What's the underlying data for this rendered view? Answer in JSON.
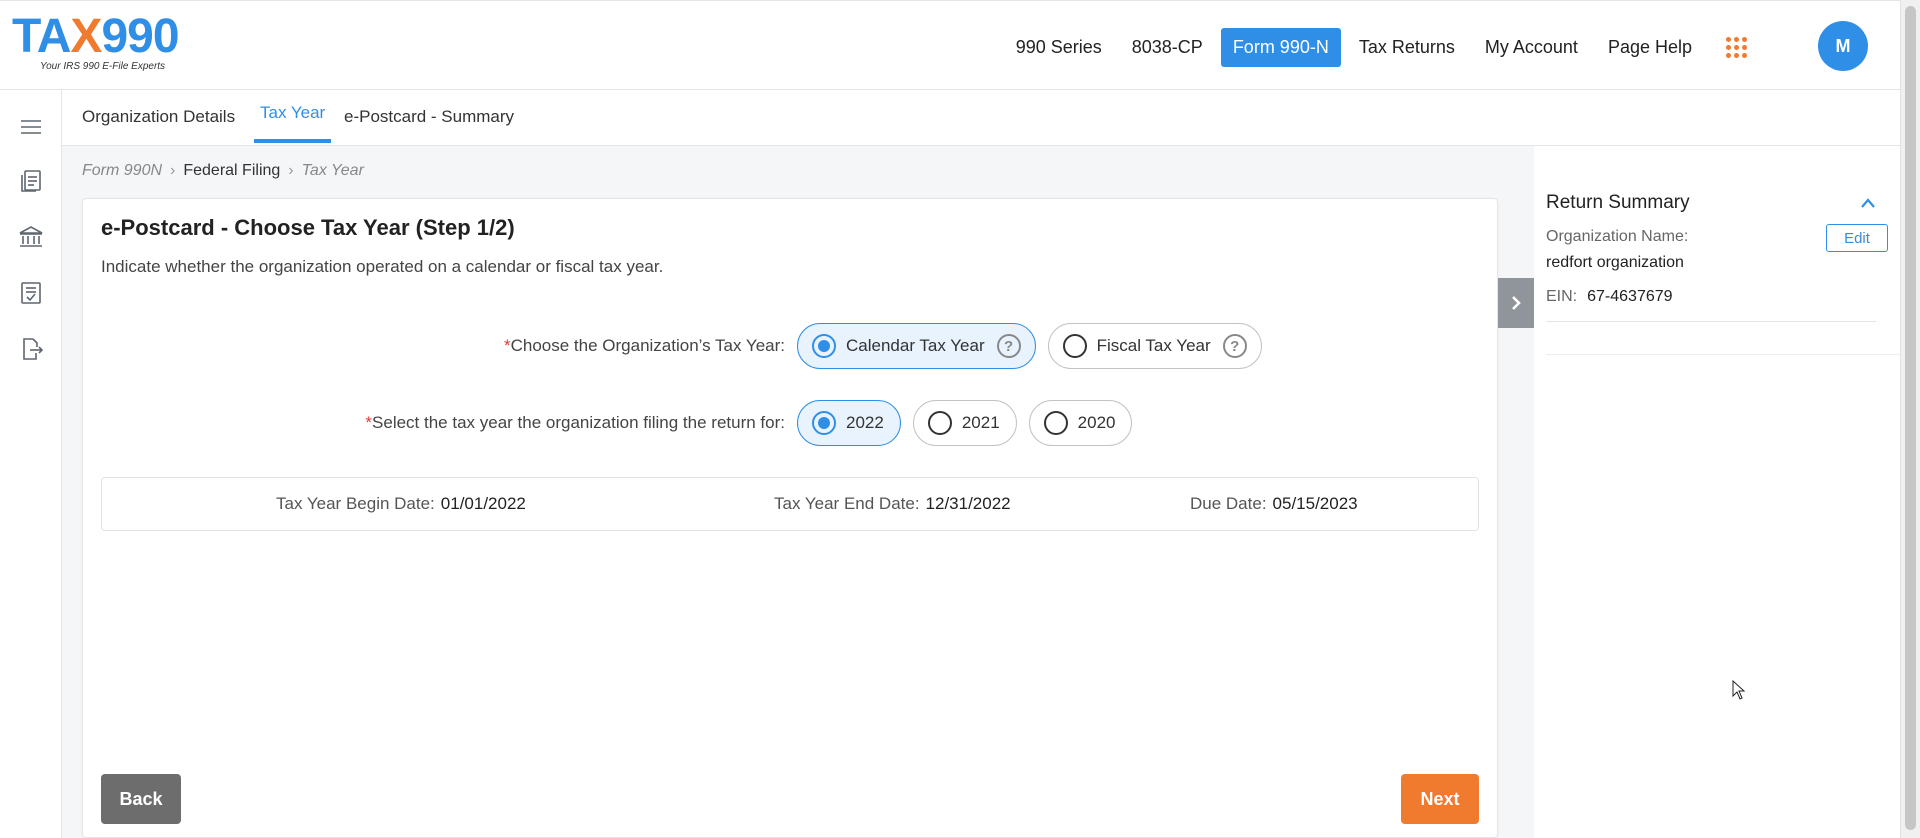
{
  "header": {
    "logo_main_a": "TA",
    "logo_main_x": "X",
    "logo_main_b": "990",
    "logo_tagline": "Your IRS 990 E-File Experts",
    "nav": [
      {
        "label": "990 Series"
      },
      {
        "label": "8038-CP"
      },
      {
        "label": "Form 990-N"
      },
      {
        "label": "Tax Returns"
      },
      {
        "label": "My Account"
      },
      {
        "label": "Page Help"
      }
    ],
    "avatar_initial": "M"
  },
  "tabs": [
    {
      "label": "Organization Details"
    },
    {
      "label": "Tax Year"
    },
    {
      "label": "e-Postcard - Summary"
    }
  ],
  "breadcrumb": {
    "items": [
      "Form 990N",
      "Federal Filing",
      "Tax Year"
    ]
  },
  "card": {
    "title": "e-Postcard - Choose Tax Year (Step 1/2)",
    "description": "Indicate whether the organization operated on a calendar or fiscal tax year.",
    "q1": {
      "required_mark": "*",
      "label": "Choose the Organization’s Tax Year:",
      "options": [
        {
          "label": "Calendar Tax Year",
          "selected": true
        },
        {
          "label": "Fiscal Tax Year",
          "selected": false
        }
      ]
    },
    "q2": {
      "required_mark": "*",
      "label": "Select the tax year the organization filing the return for:",
      "options": [
        {
          "label": "2022",
          "selected": true
        },
        {
          "label": "2021",
          "selected": false
        },
        {
          "label": "2020",
          "selected": false
        }
      ]
    },
    "dates": {
      "begin_label": "Tax Year Begin Date:",
      "begin_value": "01/01/2022",
      "end_label": "Tax Year End Date:",
      "end_value": "12/31/2022",
      "due_label": "Due Date:",
      "due_value": "05/15/2023"
    },
    "back_label": "Back",
    "next_label": "Next"
  },
  "summary": {
    "title": "Return Summary",
    "org_name_label": "Organization Name:",
    "org_name_value": "redfort organization",
    "edit_label": "Edit",
    "ein_label": "EIN:",
    "ein_value": "67-4637679"
  },
  "colors": {
    "brand_blue": "#2f8fe6",
    "brand_orange": "#f07a2e"
  },
  "icons": [
    "menu-icon",
    "documents-icon",
    "bank-icon",
    "checklist-icon",
    "file-export-icon",
    "apps-grid-icon",
    "help-icon",
    "chevron-right-icon",
    "chevron-up-icon"
  ]
}
